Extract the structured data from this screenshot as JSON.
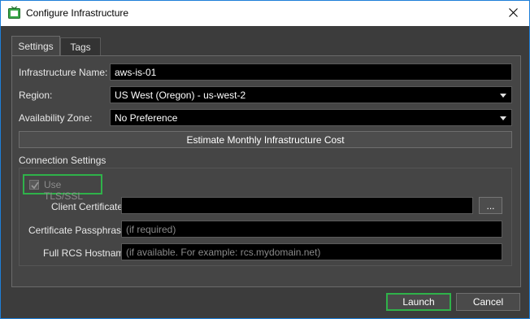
{
  "window": {
    "title": "Configure Infrastructure",
    "app_icon": "tv-monitor-icon",
    "close_icon": "close-icon"
  },
  "tabs": [
    {
      "label": "Settings",
      "active": true
    },
    {
      "label": "Tags",
      "active": false
    }
  ],
  "settings": {
    "infrastructure_name_label": "Infrastructure Name:",
    "infrastructure_name_value": "aws-is-01",
    "region_label": "Region:",
    "region_value": "US West (Oregon) - us-west-2",
    "availability_zone_label": "Availability Zone:",
    "availability_zone_value": "No Preference",
    "estimate_button": "Estimate Monthly Infrastructure Cost"
  },
  "connection": {
    "group_label": "Connection Settings",
    "tls_label": "Use TLS/SSL",
    "tls_checked": true,
    "client_cert_label": "Client Certificate",
    "client_cert_value": "",
    "browse_button": "...",
    "passphrase_label": "Certificate Passphrase",
    "passphrase_placeholder": "(if required)",
    "hostname_label": "Full RCS Hostname",
    "hostname_placeholder": "(if available. For example: rcs.mydomain.net)"
  },
  "footer": {
    "launch_button": "Launch",
    "cancel_button": "Cancel"
  },
  "colors": {
    "accent_green": "#2fb24a",
    "window_border": "#1e7fd8",
    "background": "#3c3c3c"
  }
}
